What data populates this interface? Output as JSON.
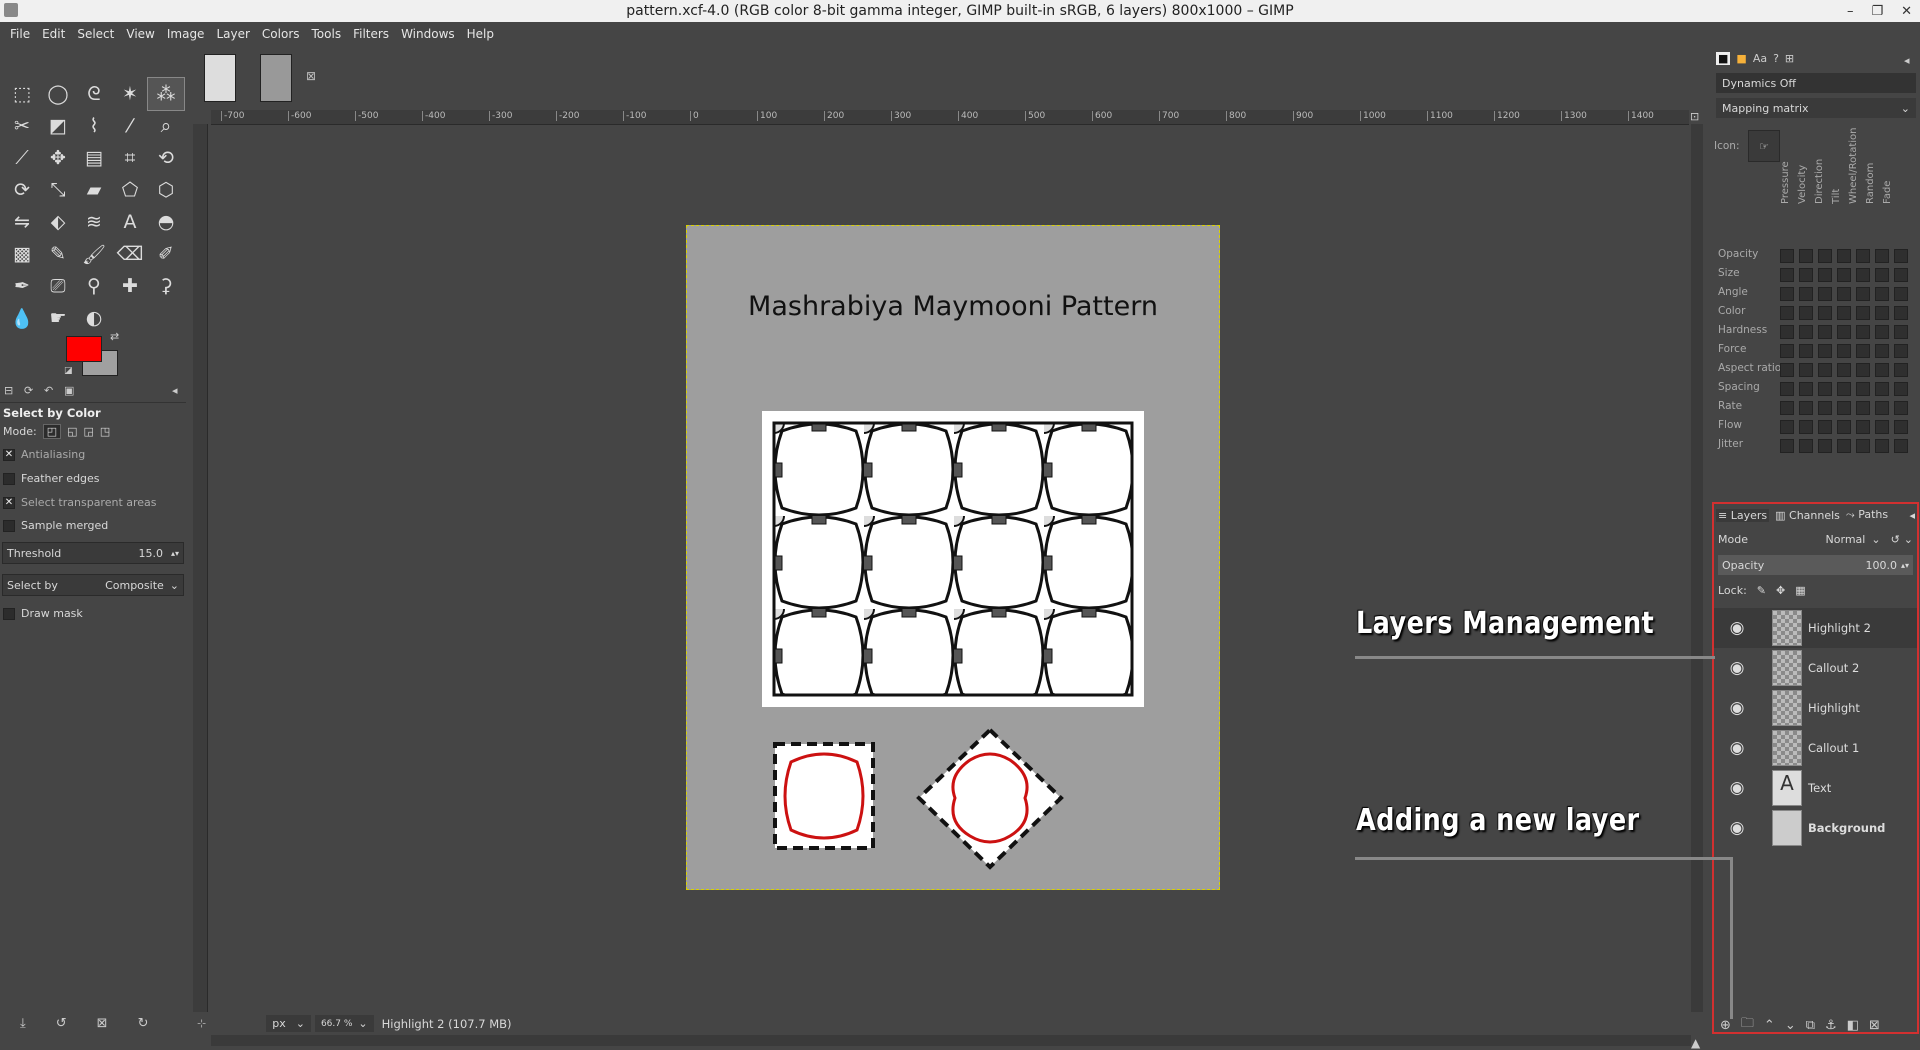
{
  "window": {
    "title": "pattern.xcf-4.0 (RGB color 8-bit gamma integer, GIMP built-in sRGB, 6 layers) 800x1000 – GIMP",
    "controls": [
      "–",
      "❐",
      "✕"
    ]
  },
  "menu": [
    "File",
    "Edit",
    "Select",
    "View",
    "Image",
    "Layer",
    "Colors",
    "Tools",
    "Filters",
    "Windows",
    "Help"
  ],
  "toolbox": {
    "tools": [
      "rect-select",
      "ellipse-select",
      "free-select",
      "fuzzy-select",
      "select-by-color",
      "scissors",
      "foreground-select",
      "paths",
      "color-picker",
      "zoom",
      "measure",
      "move",
      "align",
      "crop",
      "unified-transform",
      "rotate",
      "scale",
      "shear",
      "perspective",
      "3d-transform",
      "flip",
      "cage-transform",
      "warp-transform",
      "text",
      "bucket-fill",
      "gradient",
      "pencil",
      "paintbrush",
      "eraser",
      "airbrush",
      "ink",
      "mypaint-brush",
      "clone",
      "heal",
      "perspective-clone",
      "blur",
      "smudge",
      "dodge-burn"
    ],
    "active_tool_index": 4,
    "fg_color": "#ff0000",
    "bg_color": "#a0a0a0"
  },
  "tool_options": {
    "title": "Select by Color",
    "mode_label": "Mode:",
    "antialiasing": "Antialiasing",
    "feather_edges": "Feather edges",
    "select_transparent": "Select transparent areas",
    "sample_merged": "Sample merged",
    "threshold_label": "Threshold",
    "threshold_value": "15.0",
    "select_by_label": "Select by",
    "select_by_value": "Composite",
    "draw_mask": "Draw mask"
  },
  "ruler": {
    "h_labels": [
      "-700",
      "-600",
      "-500",
      "-400",
      "-300",
      "-200",
      "-100",
      "0",
      "100",
      "200",
      "300",
      "400",
      "500",
      "600",
      "700",
      "800",
      "900",
      "1000",
      "1100",
      "1200",
      "1300",
      "1400"
    ]
  },
  "image": {
    "title": "Mashrabiya Maymooni Pattern"
  },
  "status": {
    "unit": "px",
    "zoom": "66.7 %",
    "message": "Highlight 2 (107.7 MB)"
  },
  "dynamics": {
    "name": "Dynamics Off",
    "matrix": "Mapping matrix",
    "icon_label": "Icon:",
    "columns": [
      "Pressure",
      "Velocity",
      "Direction",
      "Tilt",
      "Wheel/Rotation",
      "Random",
      "Fade"
    ],
    "rows": [
      "Opacity",
      "Size",
      "Angle",
      "Color",
      "Hardness",
      "Force",
      "Aspect ratio",
      "Spacing",
      "Rate",
      "Flow",
      "Jitter"
    ]
  },
  "layers_dock": {
    "tabs": [
      "Layers",
      "Channels",
      "Paths"
    ],
    "mode_label": "Mode",
    "mode_value": "Normal",
    "opacity_label": "Opacity",
    "opacity_value": "100.0",
    "lock_label": "Lock:",
    "layers": [
      "Highlight 2",
      "Callout 2",
      "Highlight",
      "Callout 1",
      "Text",
      "Background"
    ],
    "selected_index": 0
  },
  "annotations": {
    "layers_mgmt": "Layers Management",
    "new_layer": "Adding a new layer"
  }
}
